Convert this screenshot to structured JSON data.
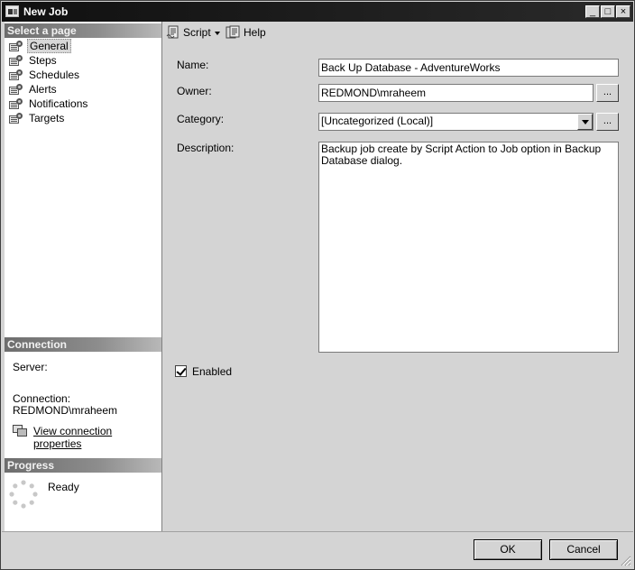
{
  "window": {
    "title": "New Job",
    "minimize_glyph": "_",
    "maximize_glyph": "□",
    "close_glyph": "×"
  },
  "sidebar": {
    "select_header": "Select a page",
    "items": [
      {
        "label": "General",
        "icon": "page-wrench-icon",
        "selected": true
      },
      {
        "label": "Steps",
        "icon": "page-wrench-icon"
      },
      {
        "label": "Schedules",
        "icon": "page-wrench-icon"
      },
      {
        "label": "Alerts",
        "icon": "page-wrench-icon"
      },
      {
        "label": "Notifications",
        "icon": "page-wrench-icon"
      },
      {
        "label": "Targets",
        "icon": "page-wrench-icon"
      }
    ],
    "connection_header": "Connection",
    "server_label": "Server:",
    "connection_label": "Connection:",
    "connection_value": "REDMOND\\mraheem",
    "view_connection_link": "View connection properties",
    "progress_header": "Progress",
    "progress_status": "Ready"
  },
  "toolbar": {
    "script_label": "Script",
    "help_label": "Help"
  },
  "form": {
    "name_label": "Name:",
    "name_value": "Back Up Database - AdventureWorks",
    "owner_label": "Owner:",
    "owner_value": "REDMOND\\mraheem",
    "category_label": "Category:",
    "category_value": "[Uncategorized (Local)]",
    "description_label": "Description:",
    "description_value": "Backup job create by Script Action to Job option in Backup Database dialog.",
    "browse_label": "...",
    "enabled_label": "Enabled",
    "enabled_checked": true
  },
  "footer": {
    "ok_label": "OK",
    "cancel_label": "Cancel"
  }
}
